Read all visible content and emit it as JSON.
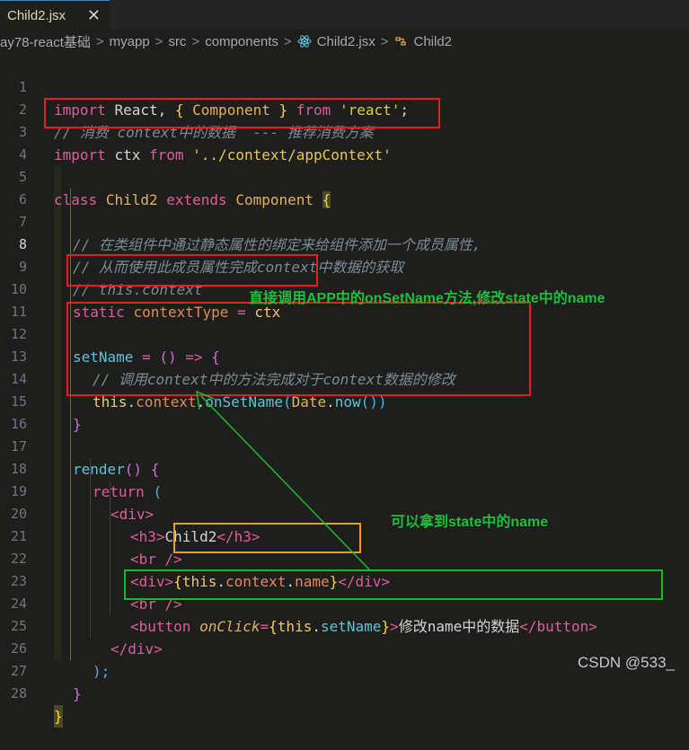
{
  "tab": {
    "filename": "Child2.jsx",
    "close": "✕"
  },
  "breadcrumb": {
    "items": [
      "ay78-react基础",
      "myapp",
      "src",
      "components",
      "Child2.jsx",
      "Child2"
    ],
    "separator": ">"
  },
  "lines": [
    {
      "n": "1"
    },
    {
      "n": "2"
    },
    {
      "n": "3"
    },
    {
      "n": "4"
    },
    {
      "n": "5"
    },
    {
      "n": "6"
    },
    {
      "n": "7"
    },
    {
      "n": "8"
    },
    {
      "n": "9"
    },
    {
      "n": "10"
    },
    {
      "n": "11"
    },
    {
      "n": "12"
    },
    {
      "n": "13"
    },
    {
      "n": "14"
    },
    {
      "n": "15"
    },
    {
      "n": "16"
    },
    {
      "n": "17"
    },
    {
      "n": "18"
    },
    {
      "n": "19"
    },
    {
      "n": "20"
    },
    {
      "n": "21"
    },
    {
      "n": "22"
    },
    {
      "n": "23"
    },
    {
      "n": "24"
    },
    {
      "n": "25"
    },
    {
      "n": "26"
    },
    {
      "n": "27"
    },
    {
      "n": "28"
    }
  ],
  "code": {
    "l1": {
      "import": "import",
      "react": "React,",
      "b1": "{",
      "component": "Component",
      "b2": "}",
      "from": "from",
      "str": "'react'",
      "semi": ";"
    },
    "l2": {
      "comment": "// 消费 context中的数据  --- 推荐消费方案"
    },
    "l3": {
      "import": "import",
      "ctx": "ctx",
      "from": "from",
      "str": "'../context/appContext'"
    },
    "l5": {
      "class": "class",
      "name": "Child2",
      "extends": "extends",
      "base": "Component",
      "brace": "{"
    },
    "l7": {
      "comment": "// 在类组件中通过静态属性的绑定来给组件添加一个成员属性,"
    },
    "l8": {
      "comment": "// 从而使用此成员属性完成context中数据的获取"
    },
    "l9": {
      "comment": "// this.context"
    },
    "l10": {
      "static": "static",
      "prop": "contextType",
      "eq": "=",
      "ctx": "ctx"
    },
    "l12": {
      "name": "setName",
      "eq": "=",
      "paren": "()",
      "arrow": "=>",
      "brace": "{"
    },
    "l13": {
      "comment": "// 调用context中的方法完成对于context数据的修改"
    },
    "l14": {
      "this": "this",
      "dot1": ".",
      "ctx": "context",
      "dot2": ".",
      "method": "onSetName",
      "p1": "(",
      "date": "Date",
      "dot3": ".",
      "now": "now",
      "p2": "())"
    },
    "l15": {
      "brace": "}"
    },
    "l17": {
      "render": "render",
      "paren": "()",
      "brace": "{"
    },
    "l18": {
      "return": "return",
      "paren": "("
    },
    "l19": {
      "open": "<div>"
    },
    "l20": {
      "h3o": "<h3>",
      "text": "Child2",
      "h3c": "</h3>"
    },
    "l21": {
      "br": "<br />"
    },
    "l22": {
      "divo": "<div>",
      "b1": "{",
      "this": "this",
      "d1": ".",
      "ctx": "context",
      "d2": ".",
      "name": "name",
      "b2": "}",
      "divc": "</div>"
    },
    "l23": {
      "br": "<br />"
    },
    "l24": {
      "bo": "<button",
      "attr": "onClick",
      "eq": "=",
      "b1": "{",
      "this": "this",
      "d": ".",
      "fn": "setName",
      "b2": "}",
      "gt": ">",
      "text": "修改name中的数据",
      "bc": "</button>"
    },
    "l25": {
      "close": "</div>"
    },
    "l26": {
      "paren": ");"
    },
    "l27": {
      "brace": "}"
    },
    "l28": {
      "brace": "}"
    }
  },
  "annotations": {
    "a1": "直接调用APP中的onSetName方法,修改state中的name",
    "a2": "可以拿到state中的name"
  },
  "watermark": "CSDN @533_",
  "colors": {
    "red_box": "#e51c2a",
    "orange_box": "#f59a23",
    "green": "#21b530"
  }
}
